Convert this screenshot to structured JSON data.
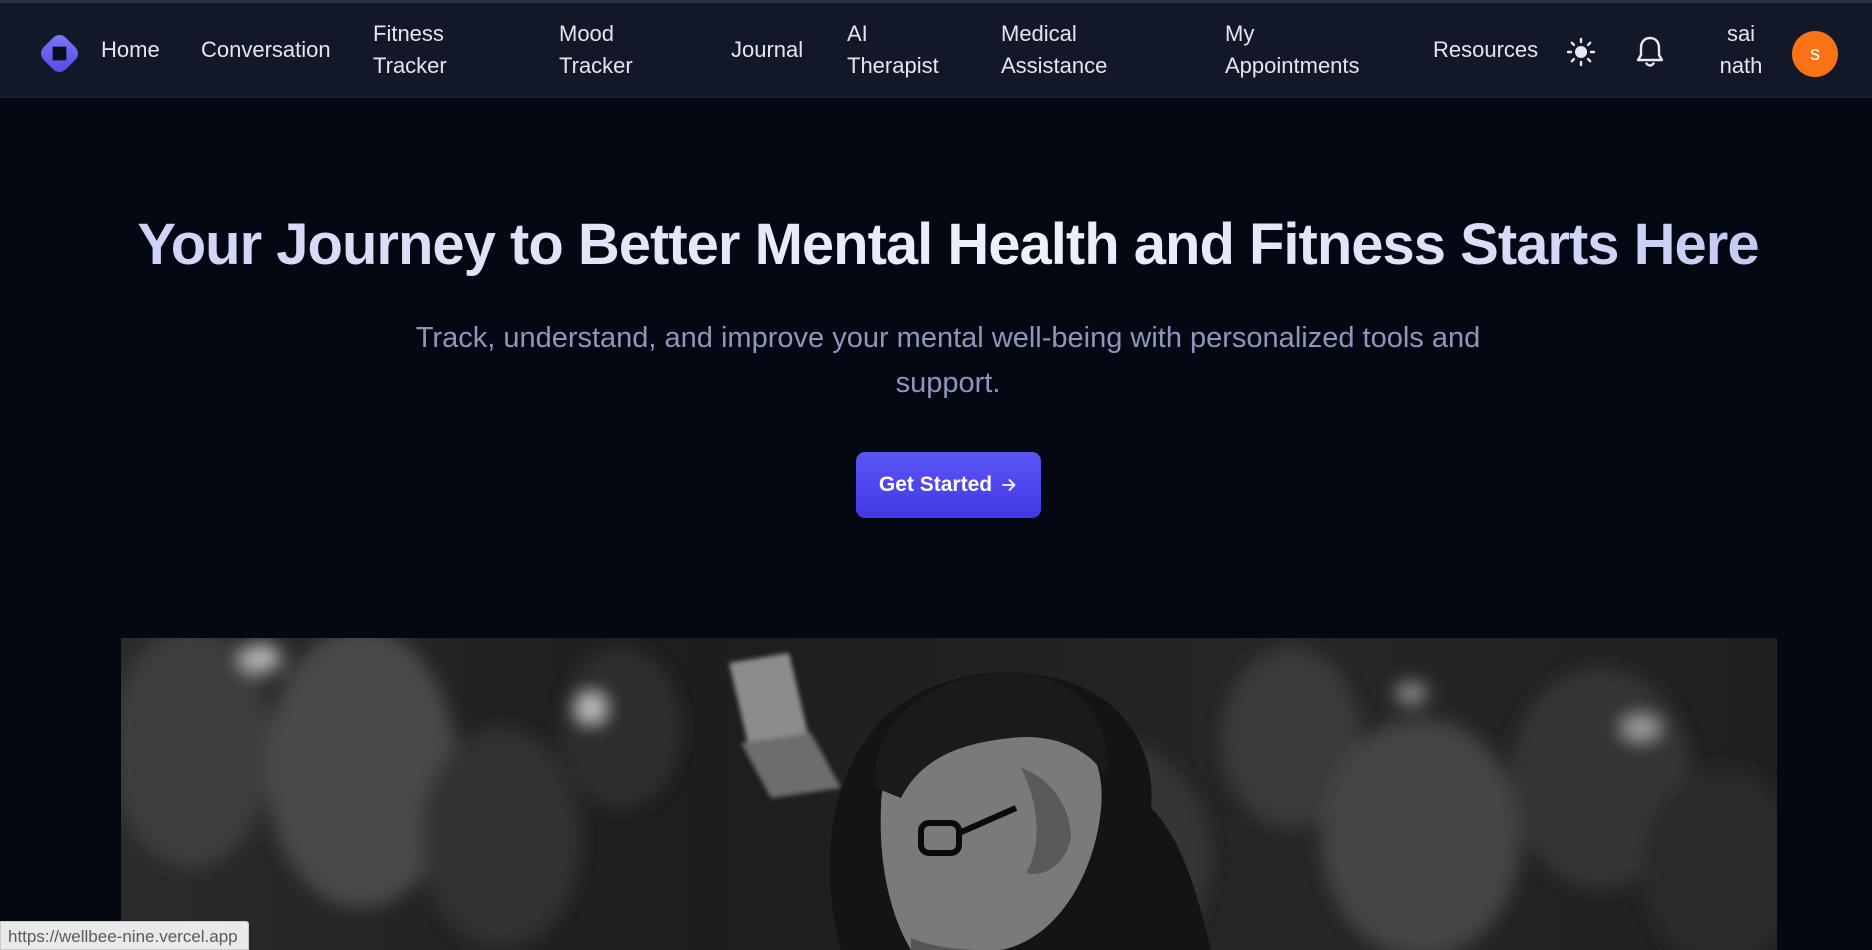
{
  "nav": {
    "items": [
      {
        "label": "Home"
      },
      {
        "label": "Conversation"
      },
      {
        "label": "Fitness Tracker"
      },
      {
        "label": "Mood Tracker"
      },
      {
        "label": "Journal"
      },
      {
        "label": "AI Therapist"
      },
      {
        "label": "Medical Assistance"
      },
      {
        "label": "My Appointments"
      },
      {
        "label": "Resources"
      }
    ],
    "user_name": "sai nath",
    "avatar_initial": "s",
    "icons": {
      "logo": "diamond-logo-icon",
      "theme": "sun-icon",
      "notifications": "bell-icon"
    }
  },
  "hero": {
    "title": "Your Journey to Better Mental Health and Fitness Starts Here",
    "subtitle": "Track, understand, and improve your mental well-being with personalized tools and support.",
    "cta_label": "Get Started",
    "cta_icon": "arrow-right-icon",
    "image_icon": "hero-photo"
  },
  "status_bar": {
    "url": "https://wellbee-nine.vercel.app"
  },
  "colors": {
    "background": "#040812",
    "navbar": "#121827",
    "accent": "#4f46e5",
    "avatar": "#f97316",
    "subtitle": "#8f96bb"
  }
}
